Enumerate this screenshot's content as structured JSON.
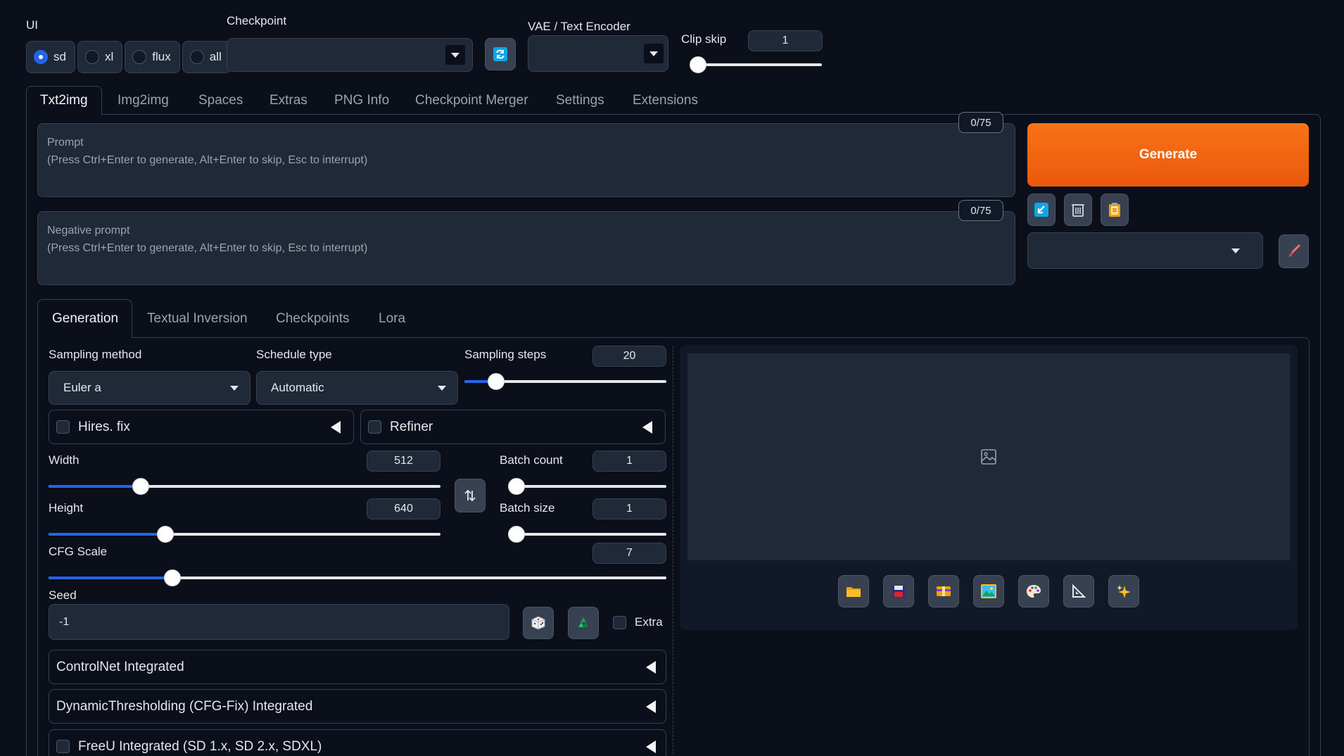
{
  "top": {
    "ui_label": "UI",
    "ui_options": [
      {
        "label": "sd",
        "selected": true
      },
      {
        "label": "xl",
        "selected": false
      },
      {
        "label": "flux",
        "selected": false
      },
      {
        "label": "all",
        "selected": false
      }
    ],
    "checkpoint_label": "Checkpoint",
    "checkpoint_value": "",
    "vae_label": "VAE / Text Encoder",
    "vae_value": "",
    "clip_skip_label": "Clip skip",
    "clip_skip_value": "1"
  },
  "main_tabs": [
    "Txt2img",
    "Img2img",
    "Spaces",
    "Extras",
    "PNG Info",
    "Checkpoint Merger",
    "Settings",
    "Extensions"
  ],
  "prompt": {
    "placeholder_line1": "Prompt",
    "placeholder_line2": "(Press Ctrl+Enter to generate, Alt+Enter to skip, Esc to interrupt)",
    "token_count": "0/75"
  },
  "negative_prompt": {
    "placeholder_line1": "Negative prompt",
    "placeholder_line2": "(Press Ctrl+Enter to generate, Alt+Enter to skip, Esc to interrupt)",
    "token_count": "0/75"
  },
  "generate_label": "Generate",
  "sub_tabs": [
    "Generation",
    "Textual Inversion",
    "Checkpoints",
    "Lora"
  ],
  "generation": {
    "sampling_method_label": "Sampling method",
    "sampling_method_value": "Euler a",
    "schedule_type_label": "Schedule type",
    "schedule_type_value": "Automatic",
    "sampling_steps_label": "Sampling steps",
    "sampling_steps_value": "20",
    "hires_fix_label": "Hires. fix",
    "refiner_label": "Refiner",
    "width_label": "Width",
    "width_value": "512",
    "height_label": "Height",
    "height_value": "640",
    "batch_count_label": "Batch count",
    "batch_count_value": "1",
    "batch_size_label": "Batch size",
    "batch_size_value": "1",
    "cfg_label": "CFG Scale",
    "cfg_value": "7",
    "seed_label": "Seed",
    "seed_value": "-1",
    "extra_label": "Extra",
    "accordions": [
      "ControlNet Integrated",
      "DynamicThresholding (CFG-Fix) Integrated",
      "FreeU Integrated (SD 1.x, SD 2.x, SDXL)"
    ]
  },
  "sliders": {
    "clip_skip": 0.0,
    "sampling_steps": 0.158,
    "width": 0.235,
    "height": 0.298,
    "batch_count": 0.0,
    "batch_size": 0.0,
    "cfg": 0.2
  },
  "colors": {
    "accent_blue": "#2563eb",
    "generate_orange": "#f97316",
    "background": "#0b0f19",
    "panel": "#1f2937"
  }
}
